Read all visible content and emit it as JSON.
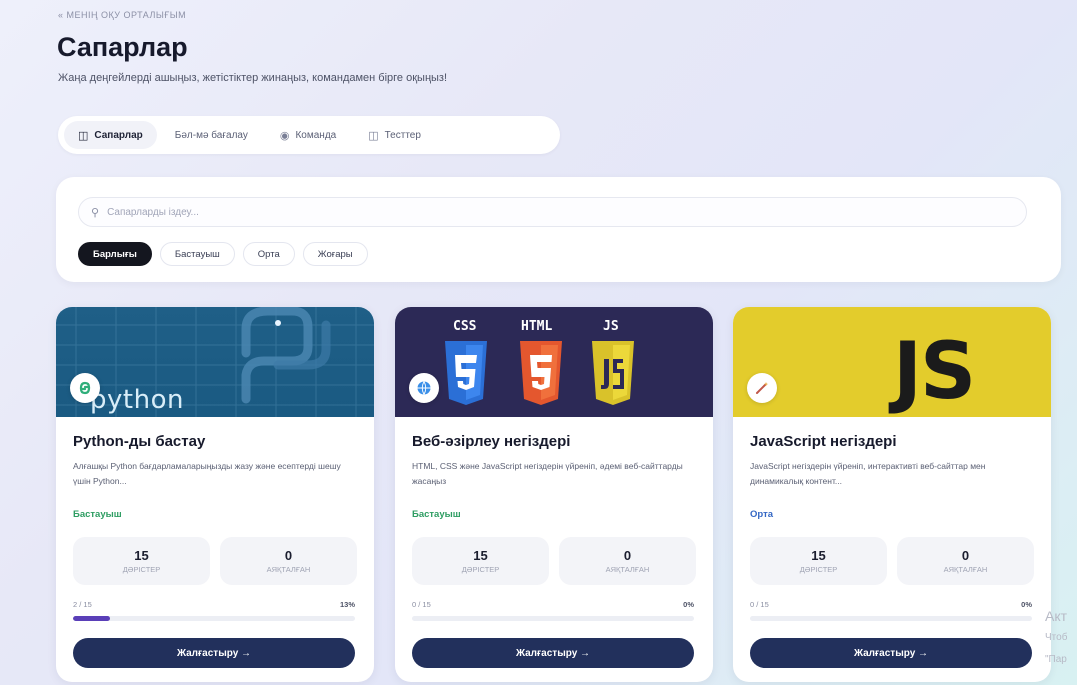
{
  "header": {
    "back_link": "« МЕНІҢ ОҚУ ОРТАЛЫҒЫМ",
    "title": "Сапарлар",
    "subtitle": "Жаңа деңгейлерді ашыңыз, жетістіктер жинаңыз, командамен бірге оқыңыз!"
  },
  "tabs": [
    {
      "label": "Сапарлар",
      "icon": "book-icon",
      "glyph": "◫",
      "active": true
    },
    {
      "label": "Бәл-мә бағалау",
      "icon": "none",
      "glyph": "",
      "active": false
    },
    {
      "label": "Команда",
      "icon": "team-icon",
      "glyph": "◉",
      "active": false
    },
    {
      "label": "Тесттер",
      "icon": "test-icon",
      "glyph": "◫",
      "active": false
    }
  ],
  "filters": {
    "search_placeholder": "Сапарларды іздеу...",
    "search_icon": "search-icon",
    "chips": [
      {
        "label": "Барлығы",
        "active": true
      },
      {
        "label": "Бастауыш",
        "active": false
      },
      {
        "label": "Орта",
        "active": false
      },
      {
        "label": "Жоғары",
        "active": false
      }
    ]
  },
  "cards": [
    {
      "cover_text": "python",
      "badge_icon": "python-logo-icon",
      "title": "Python-ды бастау",
      "description": "Алғашқы Python бағдарламаларыңызды жазу және есептерді шешу үшін Python...",
      "level": "Бастауыш",
      "level_color": "#2e9d62",
      "lessons_count": "15",
      "lessons_label": "ДӘРІСТЕР",
      "completed_count": "0",
      "completed_label": "АЯҚТАЛҒАН",
      "progress_text": "2 / 15",
      "progress_pct_label": "13%",
      "progress_fraction": 0.13,
      "cta_label": "Жалғастыру →"
    },
    {
      "cover_labels": [
        "CSS",
        "HTML",
        "JS"
      ],
      "badge_icon": "globe-icon",
      "title": "Веб-әзірлеу негіздері",
      "description": "HTML, CSS және JavaScript негіздерін үйреніп, әдемі веб-сайттарды жасаңыз",
      "level": "Бастауыш",
      "level_color": "#2e9d62",
      "lessons_count": "15",
      "lessons_label": "ДӘРІСТЕР",
      "completed_count": "0",
      "completed_label": "АЯҚТАЛҒАН",
      "progress_text": "0 / 15",
      "progress_pct_label": "0%",
      "progress_fraction": 0,
      "cta_label": "Жалғастыру →"
    },
    {
      "cover_text": "JS",
      "badge_icon": "wand-icon",
      "title": "JavaScript негіздері",
      "description": "JavaScript негіздерін үйреніп, интерактивті веб-сайттар мен динамикалық контент...",
      "level": "Орта",
      "level_color": "#3467c4",
      "lessons_count": "15",
      "lessons_label": "ДӘРІСТЕР",
      "completed_count": "0",
      "completed_label": "АЯҚТАЛҒАН",
      "progress_text": "0 / 15",
      "progress_pct_label": "0%",
      "progress_fraction": 0,
      "cta_label": "Жалғастыру →"
    }
  ],
  "watermark": {
    "line1": "Акт",
    "line2": "Чтоб",
    "line3": "\"Пар"
  },
  "colors": {
    "accent": "#22305c",
    "progress": "#5a3fb8",
    "level_beginner": "#2e9d62",
    "level_mid": "#3467c4"
  }
}
